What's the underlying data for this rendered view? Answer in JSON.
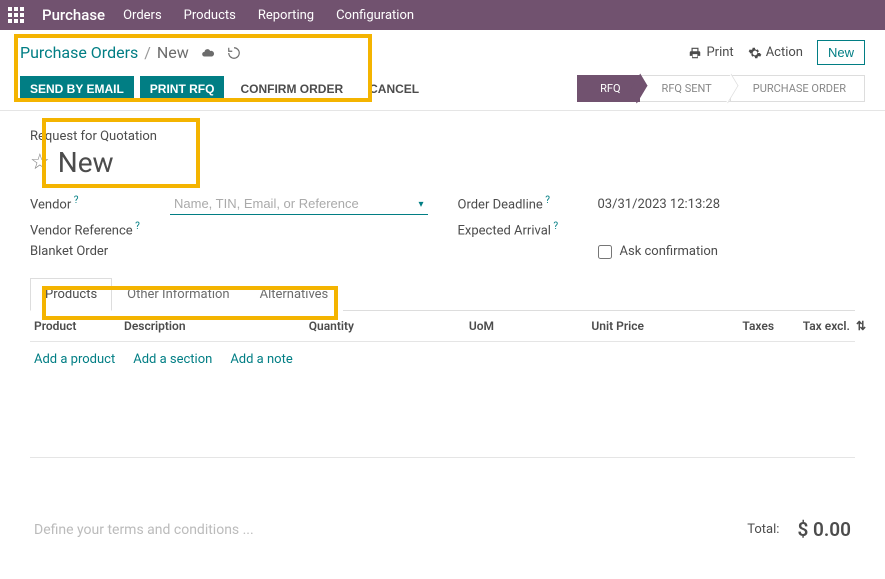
{
  "nav": {
    "brand": "Purchase",
    "menu": [
      "Orders",
      "Products",
      "Reporting",
      "Configuration"
    ]
  },
  "breadcrumb": {
    "root": "Purchase Orders",
    "current": "New"
  },
  "top_actions": {
    "print": "Print",
    "action": "Action",
    "new": "New"
  },
  "buttons": {
    "send_email": "SEND BY EMAIL",
    "print_rfq": "PRINT RFQ",
    "confirm": "CONFIRM ORDER",
    "cancel": "CANCEL"
  },
  "stages": [
    "RFQ",
    "RFQ SENT",
    "PURCHASE ORDER"
  ],
  "stage_active": 0,
  "sheet": {
    "subtitle": "Request for Quotation",
    "title": "New"
  },
  "fields": {
    "vendor_label": "Vendor",
    "vendor_placeholder": "Name, TIN, Email, or Reference",
    "vendor_ref_label": "Vendor Reference",
    "blanket_label": "Blanket Order",
    "deadline_label": "Order Deadline",
    "deadline_value": "03/31/2023 12:13:28",
    "expected_label": "Expected Arrival",
    "ask_conf_label": "Ask confirmation"
  },
  "tabs": [
    "Products",
    "Other Information",
    "Alternatives"
  ],
  "tab_active": 0,
  "columns": {
    "product": "Product",
    "description": "Description",
    "quantity": "Quantity",
    "uom": "UoM",
    "unit_price": "Unit Price",
    "taxes": "Taxes",
    "tax_excl": "Tax excl."
  },
  "add_links": {
    "product": "Add a product",
    "section": "Add a section",
    "note": "Add a note"
  },
  "terms_placeholder": "Define your terms and conditions ...",
  "totals": {
    "total_label": "Total:",
    "total_value": "$ 0.00"
  }
}
